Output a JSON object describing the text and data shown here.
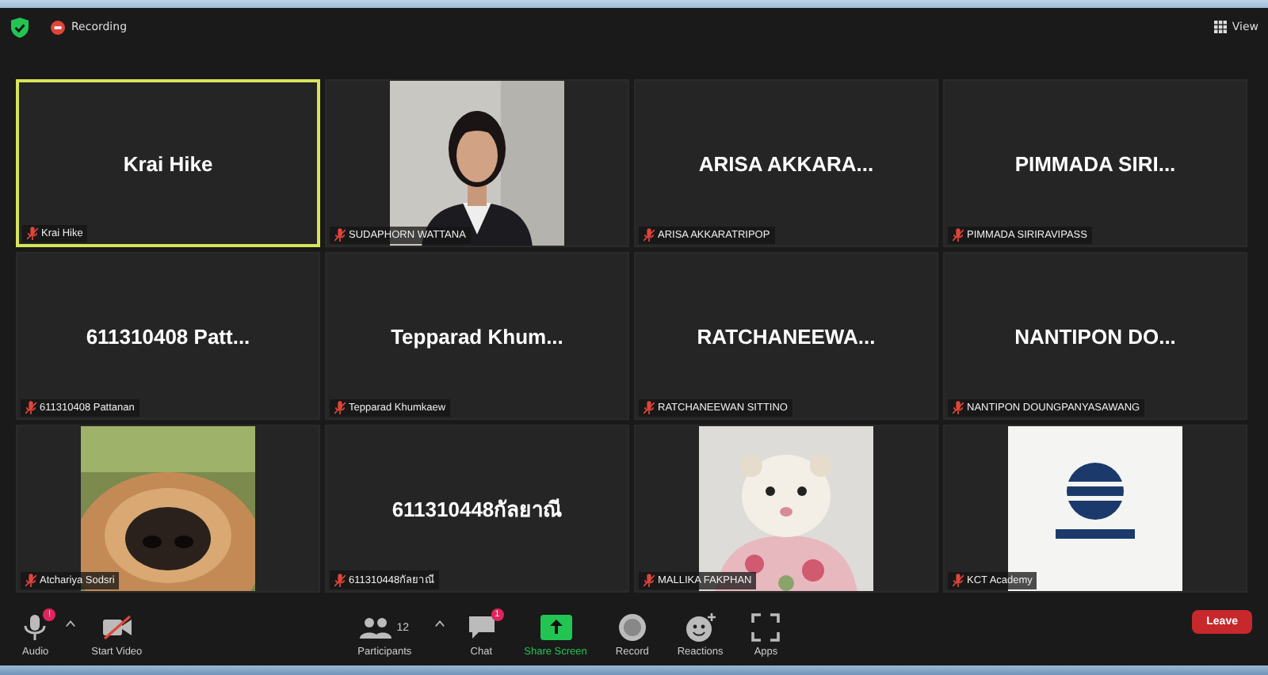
{
  "top_bar": {
    "recording": "Recording",
    "view": "View"
  },
  "tiles": [
    {
      "kind": "name",
      "display": "Krai Hike",
      "label": "Krai Hike",
      "muted": true,
      "selected": true
    },
    {
      "kind": "picture",
      "label": "SUDAPHORN WATTANA",
      "muted": true,
      "selected": false
    },
    {
      "kind": "name",
      "display": "ARISA  AKKARA...",
      "label": "ARISA AKKARATRIPOP",
      "muted": true,
      "selected": false
    },
    {
      "kind": "name",
      "display": "PIMMADA SIRI...",
      "label": "PIMMADA SIRIRAVIPASS",
      "muted": true,
      "selected": false
    },
    {
      "kind": "name",
      "display": "611310408  Patt...",
      "label": "611310408 Pattanan",
      "muted": true,
      "selected": false
    },
    {
      "kind": "name",
      "display": "Tepparad  Khum...",
      "label": "Tepparad Khumkaew",
      "muted": true,
      "selected": false
    },
    {
      "kind": "name",
      "display": "RATCHANEEWA...",
      "label": "RATCHANEEWAN SITTINO",
      "muted": true,
      "selected": false
    },
    {
      "kind": "name",
      "display": "NANTIPON  DO...",
      "label": "NANTIPON DOUNGPANYASAWANG",
      "muted": true,
      "selected": false
    },
    {
      "kind": "picture",
      "label": "Atchariya Sodsri",
      "muted": true,
      "selected": false
    },
    {
      "kind": "name",
      "display": "611310448กัลยาณี",
      "label": "611310448กัลยาณี",
      "muted": true,
      "selected": false
    },
    {
      "kind": "picture",
      "label": "MALLIKA FAKPHAN",
      "muted": true,
      "selected": false
    },
    {
      "kind": "picture",
      "label": "KCT Academy",
      "muted": true,
      "selected": false
    }
  ],
  "toolbar": {
    "items": [
      {
        "kind": "audio",
        "label": "Audio",
        "badge": "!"
      },
      {
        "kind": "video",
        "label": "Start Video"
      },
      {
        "kind": "participants",
        "label": "Participants",
        "count": "12"
      },
      {
        "kind": "chat",
        "label": "Chat",
        "badge": "1"
      },
      {
        "kind": "share",
        "label": "Share Screen"
      },
      {
        "kind": "record",
        "label": "Record"
      },
      {
        "kind": "reactions",
        "label": "Reactions"
      },
      {
        "kind": "apps",
        "label": "Apps"
      }
    ],
    "leave": "Leave"
  }
}
